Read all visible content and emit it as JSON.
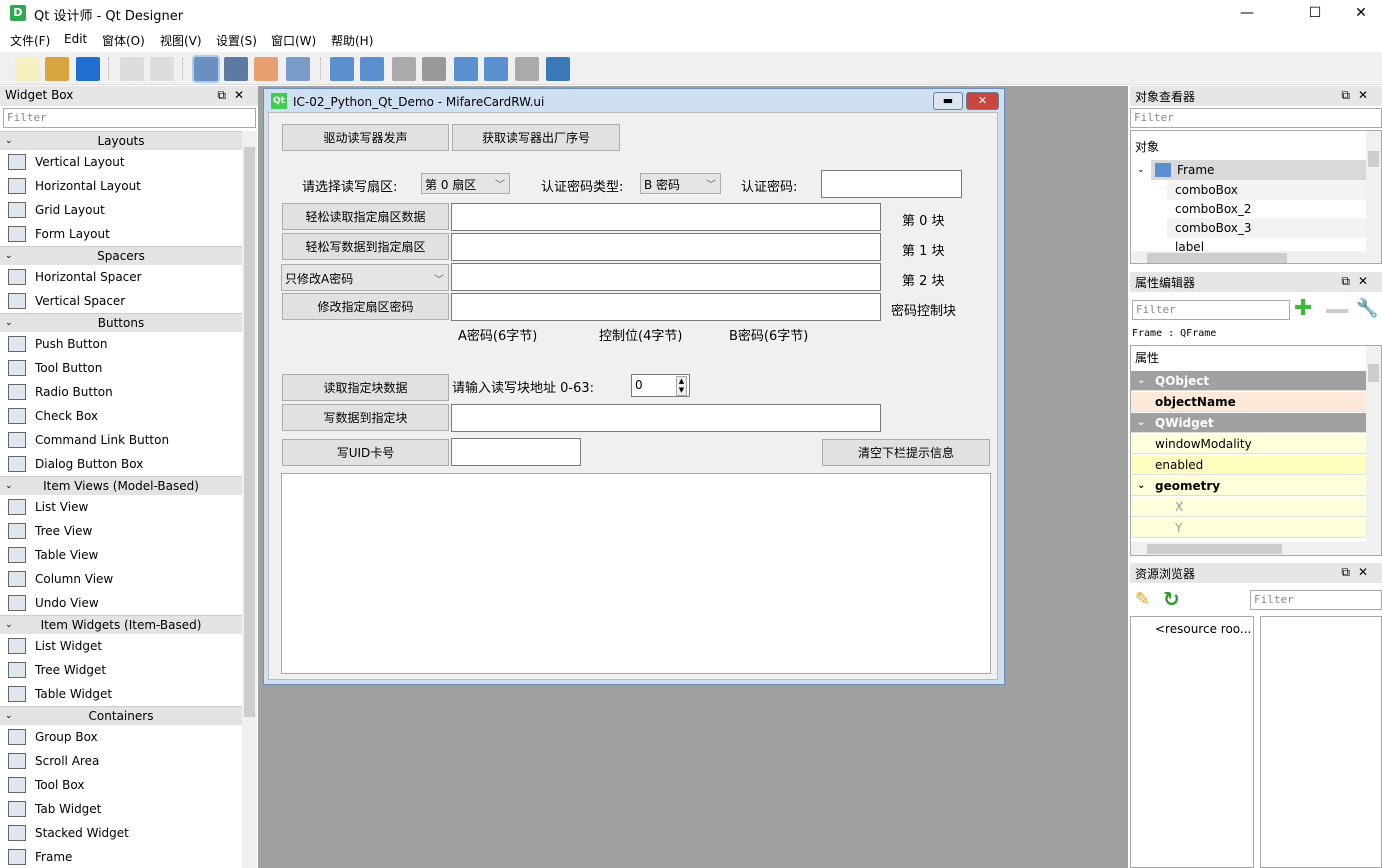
{
  "app": {
    "title": "Qt 设计师 - Qt Designer",
    "icon_letter": "D",
    "minimize": "—",
    "maximize": "☐",
    "close": "✕"
  },
  "menu": [
    "文件(F)",
    "Edit",
    "窗体(O)",
    "视图(V)",
    "设置(S)",
    "窗口(W)",
    "帮助(H)"
  ],
  "toolbar": [
    "new-file",
    "open-folder",
    "save",
    "bring-front",
    "send-back",
    "edit-widgets",
    "edit-signals",
    "edit-buddies",
    "edit-tab-order",
    "layout-horizontal",
    "layout-vertical",
    "layout-h-splitter",
    "layout-v-splitter",
    "layout-grid",
    "layout-form",
    "break-layout",
    "adjust-size"
  ],
  "widget_box": {
    "title": "Widget Box",
    "filter_placeholder": "Filter",
    "categories": [
      {
        "label": "Layouts",
        "items": [
          "Vertical Layout",
          "Horizontal Layout",
          "Grid Layout",
          "Form Layout"
        ]
      },
      {
        "label": "Spacers",
        "items": [
          "Horizontal Spacer",
          "Vertical Spacer"
        ]
      },
      {
        "label": "Buttons",
        "items": [
          "Push Button",
          "Tool Button",
          "Radio Button",
          "Check Box",
          "Command Link Button",
          "Dialog Button Box"
        ]
      },
      {
        "label": "Item Views (Model-Based)",
        "items": [
          "List View",
          "Tree View",
          "Table View",
          "Column View",
          "Undo View"
        ]
      },
      {
        "label": "Item Widgets (Item-Based)",
        "items": [
          "List Widget",
          "Tree Widget",
          "Table Widget"
        ]
      },
      {
        "label": "Containers",
        "items": [
          "Group Box",
          "Scroll Area",
          "Tool Box",
          "Tab Widget",
          "Stacked Widget",
          "Frame"
        ]
      }
    ]
  },
  "form": {
    "title": "IC-02_Python_Qt_Demo - MifareCardRW.ui",
    "qt_icon": "Qt",
    "btn_beep": "驱动读写器发声",
    "btn_serial": "获取读写器出厂序号",
    "lbl_sector": "请选择读写扇区:",
    "combo_sector": "第 0 扇区",
    "lbl_keytype": "认证密码类型:",
    "combo_keytype": "B 密码",
    "lbl_key": "认证密码:",
    "btn_read_sector": "轻松读取指定扇区数据",
    "btn_write_sector": "轻松写数据到指定扇区",
    "combo_modify": "只修改A密码",
    "btn_modify_key": "修改指定扇区密码",
    "block0": "第 0 块",
    "block1": "第 1 块",
    "block2": "第 2 块",
    "block_ctrl": "密码控制块",
    "lbl_keya": "A密码(6字节)",
    "lbl_ctrl": "控制位(4字节)",
    "lbl_keyb": "B密码(6字节)",
    "btn_read_block": "读取指定块数据",
    "lbl_addr": "请输入读写块地址 0-63:",
    "spin_addr": "0",
    "btn_write_block": "写数据到指定块",
    "btn_write_uid": "写UID卡号",
    "btn_clear": "清空下栏提示信息"
  },
  "object_inspector": {
    "title": "对象查看器",
    "filter_placeholder": "Filter",
    "header": "对象",
    "root": "Frame",
    "children": [
      "comboBox",
      "comboBox_2",
      "comboBox_3",
      "label"
    ]
  },
  "property_editor": {
    "title": "属性编辑器",
    "filter_placeholder": "Filter",
    "object_label": "Frame : QFrame",
    "header": "属性",
    "rows": [
      {
        "name": "QObject",
        "kind": "group"
      },
      {
        "name": "objectName",
        "kind": "bold"
      },
      {
        "name": "QWidget",
        "kind": "group"
      },
      {
        "name": "windowModality",
        "kind": "normal"
      },
      {
        "name": "enabled",
        "kind": "normal"
      },
      {
        "name": "geometry",
        "kind": "boldexp"
      },
      {
        "name": "X",
        "kind": "sub"
      },
      {
        "name": "Y",
        "kind": "sub"
      }
    ]
  },
  "resource_browser": {
    "title": "资源浏览器",
    "filter_placeholder": "Filter",
    "root": "<resource roo..."
  }
}
